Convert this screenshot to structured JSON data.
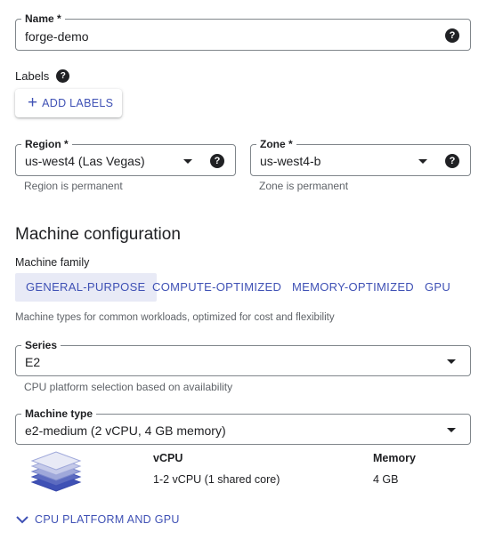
{
  "name_field": {
    "label": "Name *",
    "value": "forge-demo",
    "help_icon": "help-circle-icon"
  },
  "labels": {
    "heading": "Labels",
    "help_icon": "help-circle-icon",
    "add_button": "ADD LABELS",
    "add_icon": "plus-icon"
  },
  "region": {
    "label": "Region *",
    "value": "us-west4 (Las Vegas)",
    "hint": "Region is permanent"
  },
  "zone": {
    "label": "Zone *",
    "value": "us-west4-b",
    "hint": "Zone is permanent"
  },
  "machine_config": {
    "title": "Machine configuration",
    "family_label": "Machine family",
    "tabs": [
      "GENERAL-PURPOSE",
      "COMPUTE-OPTIMIZED",
      "MEMORY-OPTIMIZED",
      "GPU"
    ],
    "active_tab": "GENERAL-PURPOSE",
    "family_description": "Machine types for common workloads, optimized for cost and flexibility"
  },
  "series": {
    "label": "Series",
    "value": "E2",
    "hint": "CPU platform selection based on availability"
  },
  "machine_type": {
    "label": "Machine type",
    "value": "e2-medium (2 vCPU, 4 GB memory)"
  },
  "specs": {
    "vcpu_header": "vCPU",
    "vcpu_value": "1-2 vCPU (1 shared core)",
    "memory_header": "Memory",
    "memory_value": "4 GB"
  },
  "expand_section": {
    "label": "CPU PLATFORM AND GPU",
    "icon": "chevron-down-icon"
  },
  "colors": {
    "accent": "#3f51b5",
    "tab_active_bg": "#e8eaf6",
    "border": "#80868b",
    "text": "#202124",
    "hint": "#5f6368"
  }
}
